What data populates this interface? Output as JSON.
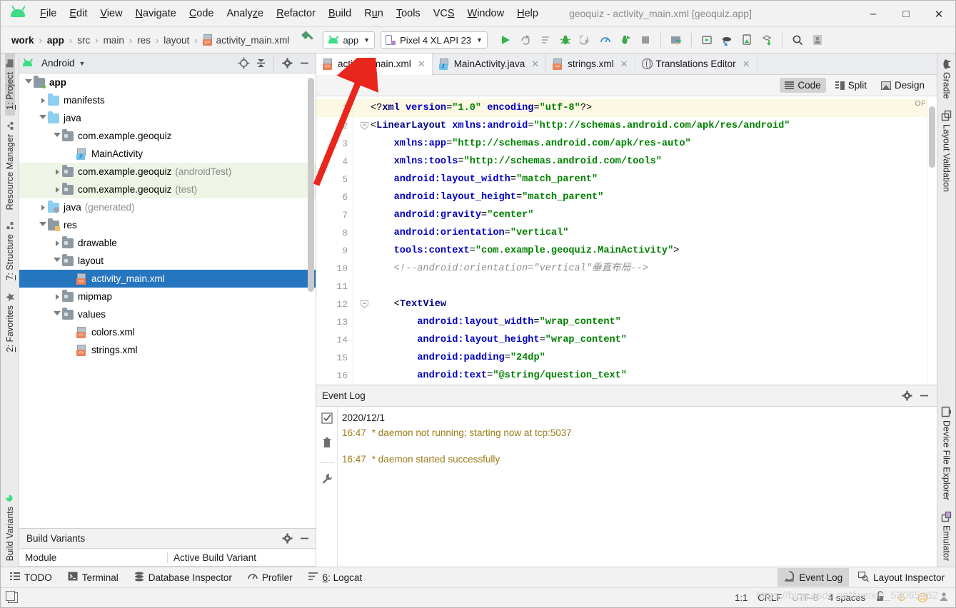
{
  "window": {
    "title": "geoquiz - activity_main.xml [geoquiz.app]",
    "minimize": "–",
    "maximize": "□",
    "close": "✕"
  },
  "menu": [
    {
      "label": "File",
      "mnemonic": "F"
    },
    {
      "label": "Edit",
      "mnemonic": "E"
    },
    {
      "label": "View",
      "mnemonic": "V"
    },
    {
      "label": "Navigate",
      "mnemonic": "N"
    },
    {
      "label": "Code",
      "mnemonic": "C"
    },
    {
      "label": "Analyze",
      "mnemonic": "z"
    },
    {
      "label": "Refactor",
      "mnemonic": "R"
    },
    {
      "label": "Build",
      "mnemonic": "B"
    },
    {
      "label": "Run",
      "mnemonic": "u"
    },
    {
      "label": "Tools",
      "mnemonic": "T"
    },
    {
      "label": "VCS",
      "mnemonic": "S"
    },
    {
      "label": "Window",
      "mnemonic": "W"
    },
    {
      "label": "Help",
      "mnemonic": "H"
    }
  ],
  "toolbar": {
    "breadcrumbs": [
      "work",
      "app",
      "src",
      "main",
      "res",
      "layout",
      "activity_main.xml"
    ],
    "run_config": "app",
    "device": "Pixel 4 XL API 23",
    "icons": [
      "run-icon",
      "rerun-icon",
      "apply-changes-icon",
      "debug-icon",
      "attach-debugger-icon",
      "profiler-icon",
      "run-with-coverage-icon",
      "stop-icon",
      "sdk-manager-icon",
      "avd-manager-icon",
      "sync-gradle-icon",
      "device-manager-icon",
      "download-icon",
      "search-icon",
      "profile-icon"
    ]
  },
  "left_rail": [
    {
      "label": "1: Project",
      "num": "1",
      "selected": true,
      "icon": "project-icon"
    },
    {
      "label": "Resource Manager",
      "num": "",
      "selected": false,
      "icon": "resource-manager-icon"
    },
    {
      "label": "7: Structure",
      "num": "7",
      "selected": false,
      "icon": "structure-icon"
    },
    {
      "label": "2: Favorites",
      "num": "2",
      "selected": false,
      "icon": "favorites-star-icon"
    },
    {
      "label": "Build Variants",
      "num": "",
      "selected": false,
      "icon": "build-variants-icon"
    }
  ],
  "right_rail": [
    {
      "label": "Gradle",
      "icon": "gradle-elephant-icon"
    },
    {
      "label": "Layout Validation",
      "icon": "layout-validation-icon"
    },
    {
      "label": "Device File Explorer",
      "icon": "device-file-explorer-icon"
    },
    {
      "label": "Emulator",
      "icon": "emulator-icon"
    }
  ],
  "project_panel": {
    "title": "Android",
    "caret": "▼",
    "toolbar_icons": [
      "locate-icon",
      "collapse-all-icon",
      "settings-gear-icon",
      "minimize-icon"
    ],
    "tree": [
      {
        "indent": 0,
        "twisty": "open",
        "icon": "module-folder",
        "label": "app",
        "bold": true,
        "sub": "",
        "selected": false,
        "shade": ""
      },
      {
        "indent": 1,
        "twisty": "closed",
        "icon": "blue-folder",
        "label": "manifests",
        "bold": false,
        "sub": "",
        "selected": false,
        "shade": ""
      },
      {
        "indent": 1,
        "twisty": "open",
        "icon": "blue-folder",
        "label": "java",
        "bold": false,
        "sub": "",
        "selected": false,
        "shade": ""
      },
      {
        "indent": 2,
        "twisty": "open",
        "icon": "package-folder",
        "label": "com.example.geoquiz",
        "bold": false,
        "sub": "",
        "selected": false,
        "shade": ""
      },
      {
        "indent": 3,
        "twisty": "none",
        "icon": "java-file",
        "label": "MainActivity",
        "bold": false,
        "sub": "",
        "selected": false,
        "shade": ""
      },
      {
        "indent": 2,
        "twisty": "closed",
        "icon": "package-folder",
        "label": "com.example.geoquiz",
        "bold": false,
        "sub": "(androidTest)",
        "selected": false,
        "shade": "green"
      },
      {
        "indent": 2,
        "twisty": "closed",
        "icon": "package-folder",
        "label": "com.example.geoquiz",
        "bold": false,
        "sub": "(test)",
        "selected": false,
        "shade": "green"
      },
      {
        "indent": 1,
        "twisty": "closed",
        "icon": "generated-folder",
        "label": "java",
        "bold": false,
        "sub": "(generated)",
        "selected": false,
        "shade": ""
      },
      {
        "indent": 1,
        "twisty": "open",
        "icon": "res-folder",
        "label": "res",
        "bold": false,
        "sub": "",
        "selected": false,
        "shade": ""
      },
      {
        "indent": 2,
        "twisty": "closed",
        "icon": "package-folder",
        "label": "drawable",
        "bold": false,
        "sub": "",
        "selected": false,
        "shade": ""
      },
      {
        "indent": 2,
        "twisty": "open",
        "icon": "package-folder",
        "label": "layout",
        "bold": false,
        "sub": "",
        "selected": false,
        "shade": ""
      },
      {
        "indent": 3,
        "twisty": "none",
        "icon": "xml-file",
        "label": "activity_main.xml",
        "bold": false,
        "sub": "",
        "selected": true,
        "shade": ""
      },
      {
        "indent": 2,
        "twisty": "closed",
        "icon": "package-folder",
        "label": "mipmap",
        "bold": false,
        "sub": "",
        "selected": false,
        "shade": ""
      },
      {
        "indent": 2,
        "twisty": "open",
        "icon": "package-folder",
        "label": "values",
        "bold": false,
        "sub": "",
        "selected": false,
        "shade": ""
      },
      {
        "indent": 3,
        "twisty": "none",
        "icon": "xml-file",
        "label": "colors.xml",
        "bold": false,
        "sub": "",
        "selected": false,
        "shade": ""
      },
      {
        "indent": 3,
        "twisty": "none",
        "icon": "xml-file",
        "label": "strings.xml",
        "bold": false,
        "sub": "",
        "selected": false,
        "shade": ""
      }
    ]
  },
  "build_variants": {
    "title": "Build Variants",
    "col_module": "Module",
    "col_variant": "Active Build Variant"
  },
  "editor": {
    "tabs": [
      {
        "label": "activity_main.xml",
        "icon": "xml-file-icon",
        "active": true,
        "close": "✕"
      },
      {
        "label": "MainActivity.java",
        "icon": "java-file-icon",
        "active": false,
        "close": "✕"
      },
      {
        "label": "strings.xml",
        "icon": "xml-file-icon",
        "active": false,
        "close": "✕"
      },
      {
        "label": "Translations Editor",
        "icon": "globe-icon",
        "active": false,
        "close": "✕"
      }
    ],
    "modes": [
      {
        "label": "Code",
        "icon": "code-view-icon",
        "selected": true
      },
      {
        "label": "Split",
        "icon": "split-view-icon",
        "selected": false
      },
      {
        "label": "Design",
        "icon": "design-view-icon",
        "selected": false
      }
    ],
    "inspection_badge": "OFF",
    "lines": [
      {
        "n": "1",
        "html": "<span class='k-pun'>&lt;?</span><span class='k-pi'>xml </span><span class='k-attr'>version</span><span class='k-pun'>=</span><span class='k-val'>\"1.0\"</span><span class='k-attr'> encoding</span><span class='k-pun'>=</span><span class='k-val'>\"utf-8\"</span><span class='k-pun'>?&gt;</span>",
        "highlight": true,
        "fold": ""
      },
      {
        "n": "2",
        "html": "<span class='k-pun'>&lt;</span><span class='k-tag'>LinearLayout</span> <span class='k-attr'>xmlns:android</span><span class='k-pun'>=</span><span class='k-val'>\"http://schemas.android.com/apk/res/android\"</span>",
        "highlight": false,
        "fold": "minus"
      },
      {
        "n": "3",
        "html": "    <span class='k-attr'>xmlns:app</span><span class='k-pun'>=</span><span class='k-val'>\"http://schemas.android.com/apk/res-auto\"</span>",
        "highlight": false,
        "fold": ""
      },
      {
        "n": "4",
        "html": "    <span class='k-attr'>xmlns:tools</span><span class='k-pun'>=</span><span class='k-val'>\"http://schemas.android.com/tools\"</span>",
        "highlight": false,
        "fold": ""
      },
      {
        "n": "5",
        "html": "    <span class='k-attr'>android:layout_width</span><span class='k-pun'>=</span><span class='k-val'>\"match_parent\"</span>",
        "highlight": false,
        "fold": ""
      },
      {
        "n": "6",
        "html": "    <span class='k-attr'>android:layout_height</span><span class='k-pun'>=</span><span class='k-val'>\"match_parent\"</span>",
        "highlight": false,
        "fold": ""
      },
      {
        "n": "7",
        "html": "    <span class='k-attr'>android:gravity</span><span class='k-pun'>=</span><span class='k-val'>\"center\"</span>",
        "highlight": false,
        "fold": ""
      },
      {
        "n": "8",
        "html": "    <span class='k-attr'>android:orientation</span><span class='k-pun'>=</span><span class='k-val'>\"vertical\"</span>",
        "highlight": false,
        "fold": ""
      },
      {
        "n": "9",
        "html": "    <span class='k-attr'>tools:context</span><span class='k-pun'>=</span><span class='k-val'>\"com.example.geoquiz.MainActivity\"</span><span class='k-pun'>&gt;</span>",
        "highlight": false,
        "fold": ""
      },
      {
        "n": "10",
        "html": "    <span class='k-cmt'>&lt;!--android:orientation=\"vertical\"垂直布局--&gt;</span>",
        "highlight": false,
        "fold": ""
      },
      {
        "n": "11",
        "html": "",
        "highlight": false,
        "fold": ""
      },
      {
        "n": "12",
        "html": "    <span class='k-pun'>&lt;</span><span class='k-tag'>TextView</span>",
        "highlight": false,
        "fold": "minus"
      },
      {
        "n": "13",
        "html": "        <span class='k-attr'>android:layout_width</span><span class='k-pun'>=</span><span class='k-val'>\"wrap_content\"</span>",
        "highlight": false,
        "fold": ""
      },
      {
        "n": "14",
        "html": "        <span class='k-attr'>android:layout_height</span><span class='k-pun'>=</span><span class='k-val'>\"wrap_content\"</span>",
        "highlight": false,
        "fold": ""
      },
      {
        "n": "15",
        "html": "        <span class='k-attr'>android:padding</span><span class='k-pun'>=</span><span class='k-val'>\"24dp\"</span>",
        "highlight": false,
        "fold": ""
      },
      {
        "n": "16",
        "html": "        <span class='k-attr'>android:text</span><span class='k-pun'>=</span><span class='k-val'>\"@string/question_text\"</span>",
        "highlight": false,
        "fold": ""
      }
    ]
  },
  "event_log": {
    "title": "Event Log",
    "rail_icons": [
      "mark-read-icon",
      "trash-icon",
      "settings-wrench-icon"
    ],
    "date": "2020/12/1",
    "entries": [
      {
        "time": "16:47",
        "message": "* daemon not running; starting now at tcp:5037"
      },
      {
        "time": "16:47",
        "message": "* daemon started successfully"
      }
    ]
  },
  "bottom_toolwindows": {
    "left": [
      {
        "label": "TODO",
        "icon": "todo-icon",
        "num": "",
        "selected": false
      },
      {
        "label": "Terminal",
        "icon": "terminal-icon",
        "num": "",
        "selected": false
      },
      {
        "label": "Database Inspector",
        "icon": "database-icon",
        "num": "",
        "selected": false
      },
      {
        "label": "Profiler",
        "icon": "profiler-icon",
        "num": "",
        "selected": false
      },
      {
        "label": "6: Logcat",
        "icon": "logcat-icon",
        "num": "6",
        "selected": false
      }
    ],
    "right": [
      {
        "label": "Event Log",
        "icon": "event-log-icon",
        "selected": true
      },
      {
        "label": "Layout Inspector",
        "icon": "layout-inspector-icon",
        "selected": false
      }
    ]
  },
  "status_bar": {
    "caret": "1:1",
    "line_separator": "CRLF",
    "encoding": "UTF-8",
    "indent": "4 spaces",
    "lock_icon": "unlocked-padlock-icon",
    "happy_icon": "☺",
    "sad_icon": "☹",
    "memory_icon": "memory-indicator-icon"
  },
  "annotation": {
    "arrow_color": "#e8261c",
    "watermark": "https://blog.csdn.net/weixin_53065462"
  }
}
